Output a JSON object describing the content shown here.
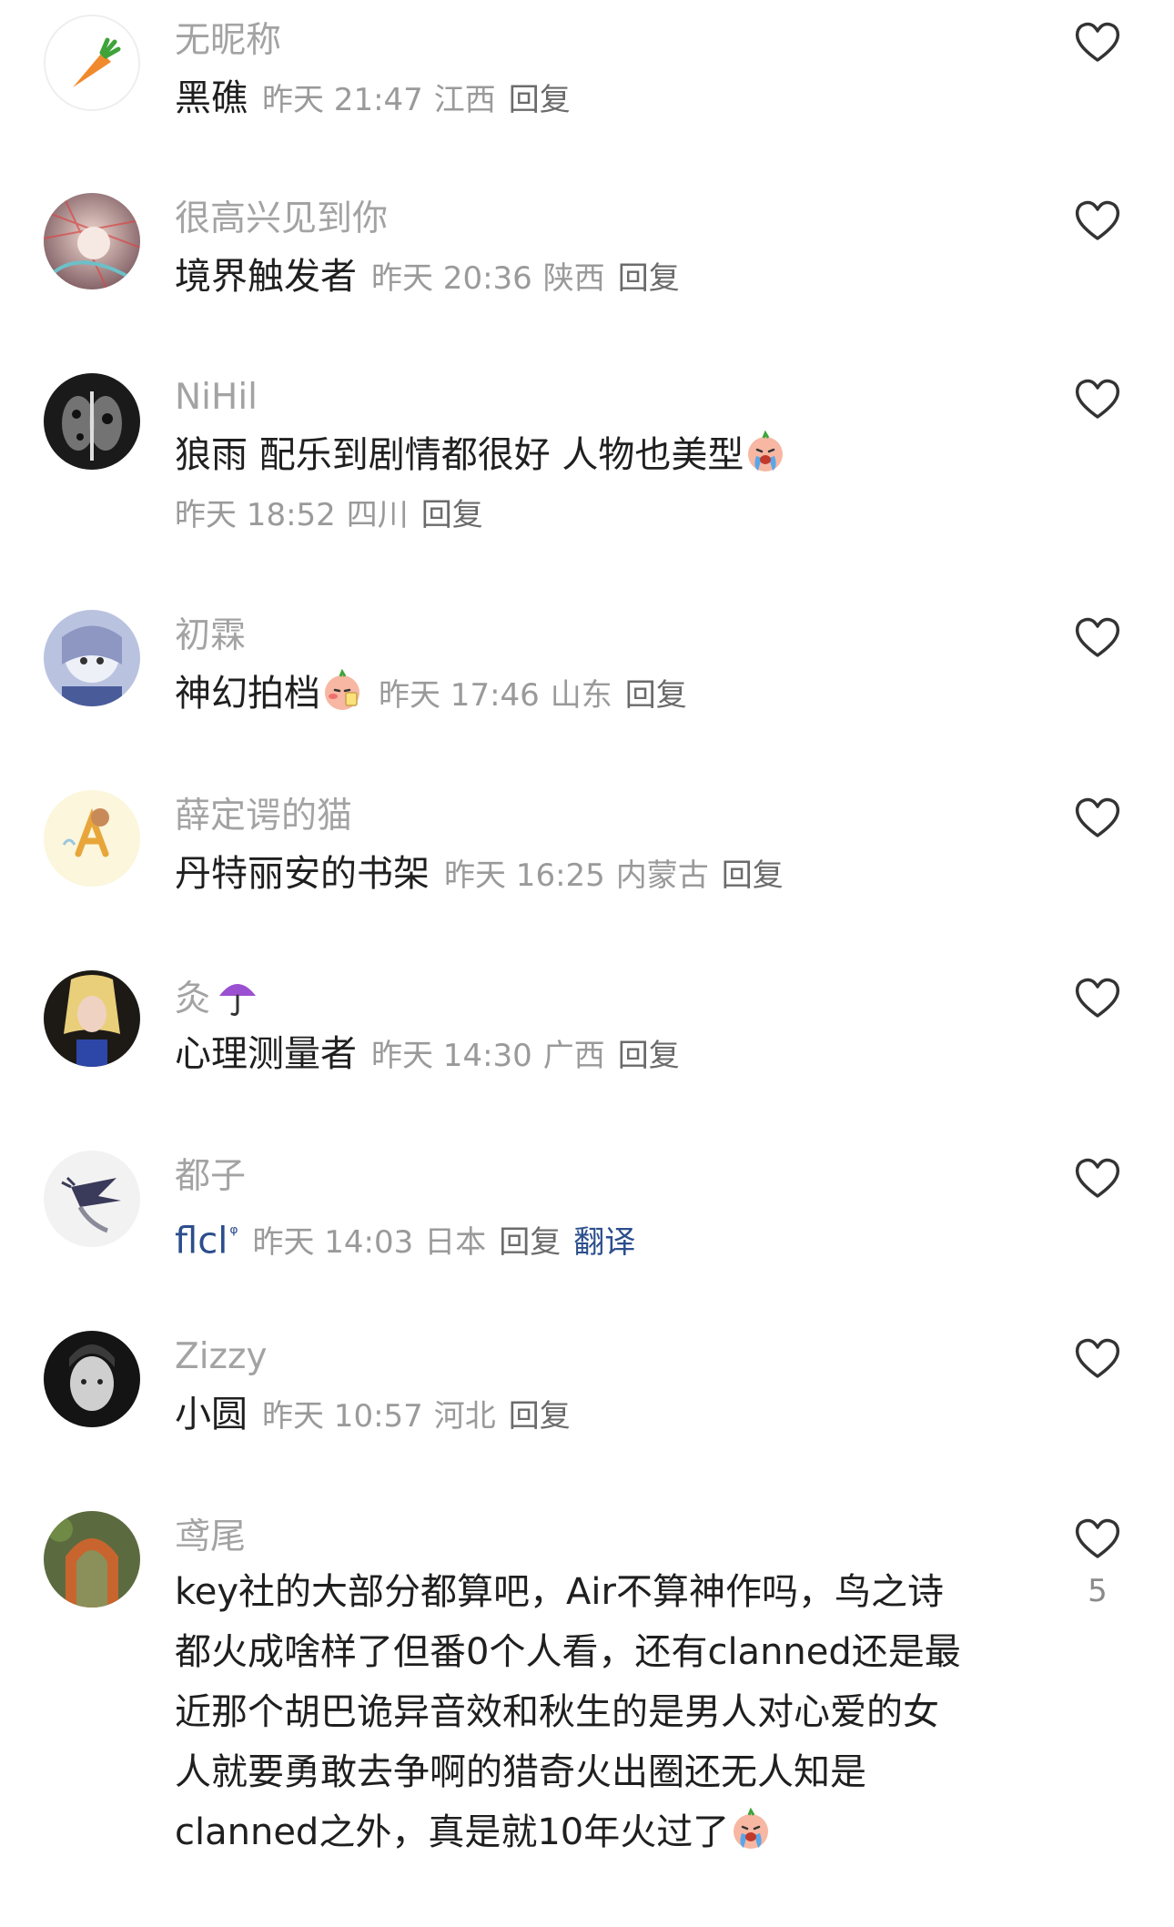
{
  "comments": [
    {
      "username": "无昵称",
      "content": "黑礁",
      "time": "昨天 21:47",
      "location": "江西",
      "reply": "回复",
      "like_count": ""
    },
    {
      "username": "很高兴见到你",
      "content": "境界触发者",
      "time": "昨天 20:36",
      "location": "陕西",
      "reply": "回复",
      "like_count": ""
    },
    {
      "username": "NiHil",
      "content": "狼雨 配乐到剧情都很好 人物也美型",
      "time": "昨天 18:52",
      "location": "四川",
      "reply": "回复",
      "like_count": ""
    },
    {
      "username": "初霖",
      "content": "神幻拍档",
      "time": "昨天 17:46",
      "location": "山东",
      "reply": "回复",
      "like_count": ""
    },
    {
      "username": "薛定谔的猫",
      "content": "丹特丽安的书架",
      "time": "昨天 16:25",
      "location": "内蒙古",
      "reply": "回复",
      "like_count": ""
    },
    {
      "username": "灸",
      "content": "心理测量者",
      "time": "昨天 14:30",
      "location": "广西",
      "reply": "回复",
      "like_count": ""
    },
    {
      "username": "都子",
      "content": "flcl",
      "time": "昨天 14:03",
      "location": "日本",
      "reply": "回复",
      "translate": "翻译",
      "like_count": ""
    },
    {
      "username": "Zizzy",
      "content": "小圆",
      "time": "昨天 10:57",
      "location": "河北",
      "reply": "回复",
      "like_count": ""
    },
    {
      "username": "鸢尾",
      "content_lines": [
        "key社的大部分都算吧，Air不算神作吗，鸟之诗",
        "都火成啥样了但番0个人看，还有clanned还是最",
        "近那个胡巴诡异音效和秋生的是男人对心爱的女",
        "人就要勇敢去争啊的猎奇火出圈还无人知是",
        "clanned之外，真是就10年火过了"
      ],
      "like_count": "5"
    }
  ],
  "colors": {
    "username": "#a3a3a3",
    "content": "#1f1f1f",
    "meta": "#9a9a9a",
    "link": "#2b4e8c"
  },
  "icons": {
    "like": "heart-outline-icon",
    "emoji_cry": "crying-face-emoji",
    "emoji_shy": "blushing-face-emoji",
    "emoji_umbrella": "umbrella-emoji",
    "search_hint": "search-superscript-icon"
  }
}
